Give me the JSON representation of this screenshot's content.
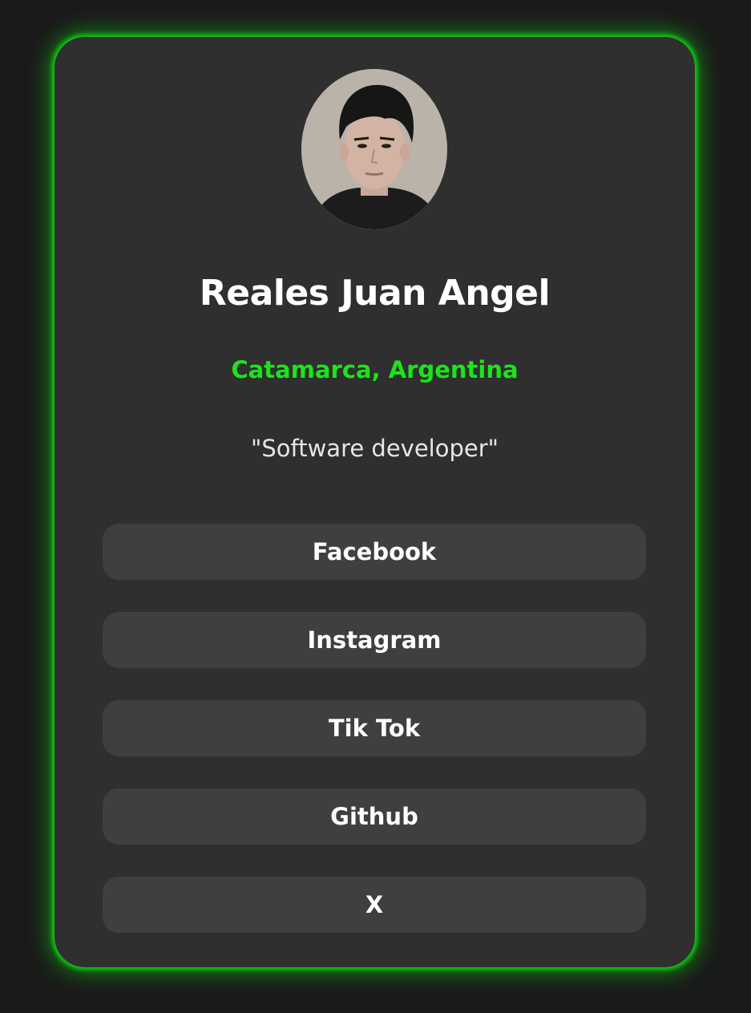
{
  "profile": {
    "name": "Reales Juan Angel",
    "location": "Catamarca, Argentina",
    "bio": "\"Software developer\""
  },
  "links": [
    {
      "label": "Facebook"
    },
    {
      "label": "Instagram"
    },
    {
      "label": "Tik Tok"
    },
    {
      "label": "Github"
    },
    {
      "label": "X"
    }
  ],
  "colors": {
    "page_background": "#1a1a1a",
    "card_background": "#2f2f2f",
    "accent_glow": "#10d410",
    "location_text": "#1be41b",
    "button_background": "#3f3f3f"
  }
}
